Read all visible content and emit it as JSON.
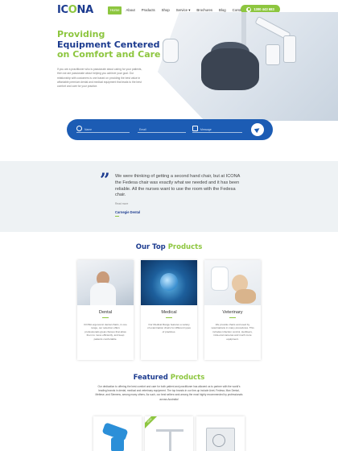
{
  "header": {
    "logo": {
      "part1": "IC",
      "part2": "O",
      "part3": "NA"
    },
    "nav": [
      "Home",
      "About",
      "Products",
      "Shop",
      "Service ▾",
      "Brochures",
      "Blog",
      "Contact Us"
    ],
    "phone": "1300 443 683"
  },
  "hero": {
    "title_line1": "Providing",
    "title_line2": "Equipment Centered",
    "title_line3": "on Comfort and Care",
    "body": "If you are a practitioner who is passionate about caring for your patients, then we are passionate about helping you achieve your goal. Our relationship with customers is one based on providing the best value in affordable premium dental and medical equipment that leads to the best comfort and care for your practice."
  },
  "form": {
    "name_label": "Name",
    "email_label": "Email",
    "message_label": "Message"
  },
  "testimonial": {
    "quote": "We were thinking of getting a second hand chair, but at ICONA the Fedesa chair was exactly what we needed and it has been reliable. All the nurses want to use the room with the Fedesa chair.",
    "read_more": "Read more",
    "author": "Carnegie Dental"
  },
  "top_products": {
    "title_main": "Our Top ",
    "title_accent": "Products",
    "cards": [
      {
        "title": "Dental",
        "text": "ICONA ergonomic dental chairs, in one range, our selection offers professionals great choices that allow them to move efficiently, and keep patients comfortable."
      },
      {
        "title": "Medical",
        "text": "Our Medical Range features a variety of examination chairs for different types of practices."
      },
      {
        "title": "Veterinary",
        "text": "We provide chairs and used by veterinarians in many procedures. This includes infection control, sterilisers, intra-oral cameras and much more equipment."
      }
    ]
  },
  "featured": {
    "title_main": "Featured ",
    "title_accent": "Products",
    "text": "Our dedication to offering the best comfort and care for both patient and practitioner has allowed us to partner with the world’s leading brands in dental, medical and veterinary equipment. The top brands in our line-up include Anet, Fedesa, Max Dental, Meltese, and Siemens, among many others. As such, our best sellers rank among the most highly recommended by professionals across Australia!",
    "badge": "NEW"
  },
  "colors": {
    "navy": "#1c3b8f",
    "green": "#8dc63f",
    "blue": "#1c5cb4"
  }
}
